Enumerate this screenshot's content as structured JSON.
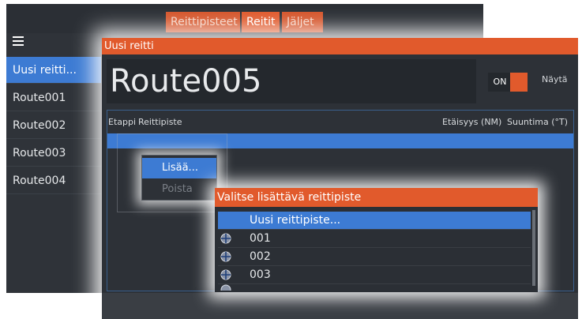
{
  "tabs": [
    {
      "label": "Reittipisteet",
      "active": false
    },
    {
      "label": "Reitit",
      "active": true
    },
    {
      "label": "Jäljet",
      "active": false
    }
  ],
  "sidebar": {
    "menu_icon": "hamburger-icon",
    "items": [
      {
        "label": "Uusi reitti...",
        "selected": true
      },
      {
        "label": "Route001",
        "selected": false
      },
      {
        "label": "Route002",
        "selected": false
      },
      {
        "label": "Route003",
        "selected": false
      },
      {
        "label": "Route004",
        "selected": false
      }
    ]
  },
  "route_dialog": {
    "title": "Uusi reitti",
    "route_name": "Route005",
    "toggle_label": "ON",
    "show_label": "Näytä",
    "columns": {
      "leg": "Etappi",
      "waypoint": "Reittipiste",
      "distance": "Etäisyys (NM)",
      "bearing": "Suuntima (°T)"
    }
  },
  "context_menu": {
    "add": "Lisää...",
    "delete": "Poista"
  },
  "waypoint_picker": {
    "title": "Valitse lisättävä reittipiste",
    "new_item": "Uusi reittipiste...",
    "items": [
      "001",
      "002",
      "003"
    ],
    "item_icon": "waypoint-icon"
  },
  "colors": {
    "accent": "#e15a2c",
    "selection": "#3d7bd3",
    "panel": "#2d3137"
  }
}
